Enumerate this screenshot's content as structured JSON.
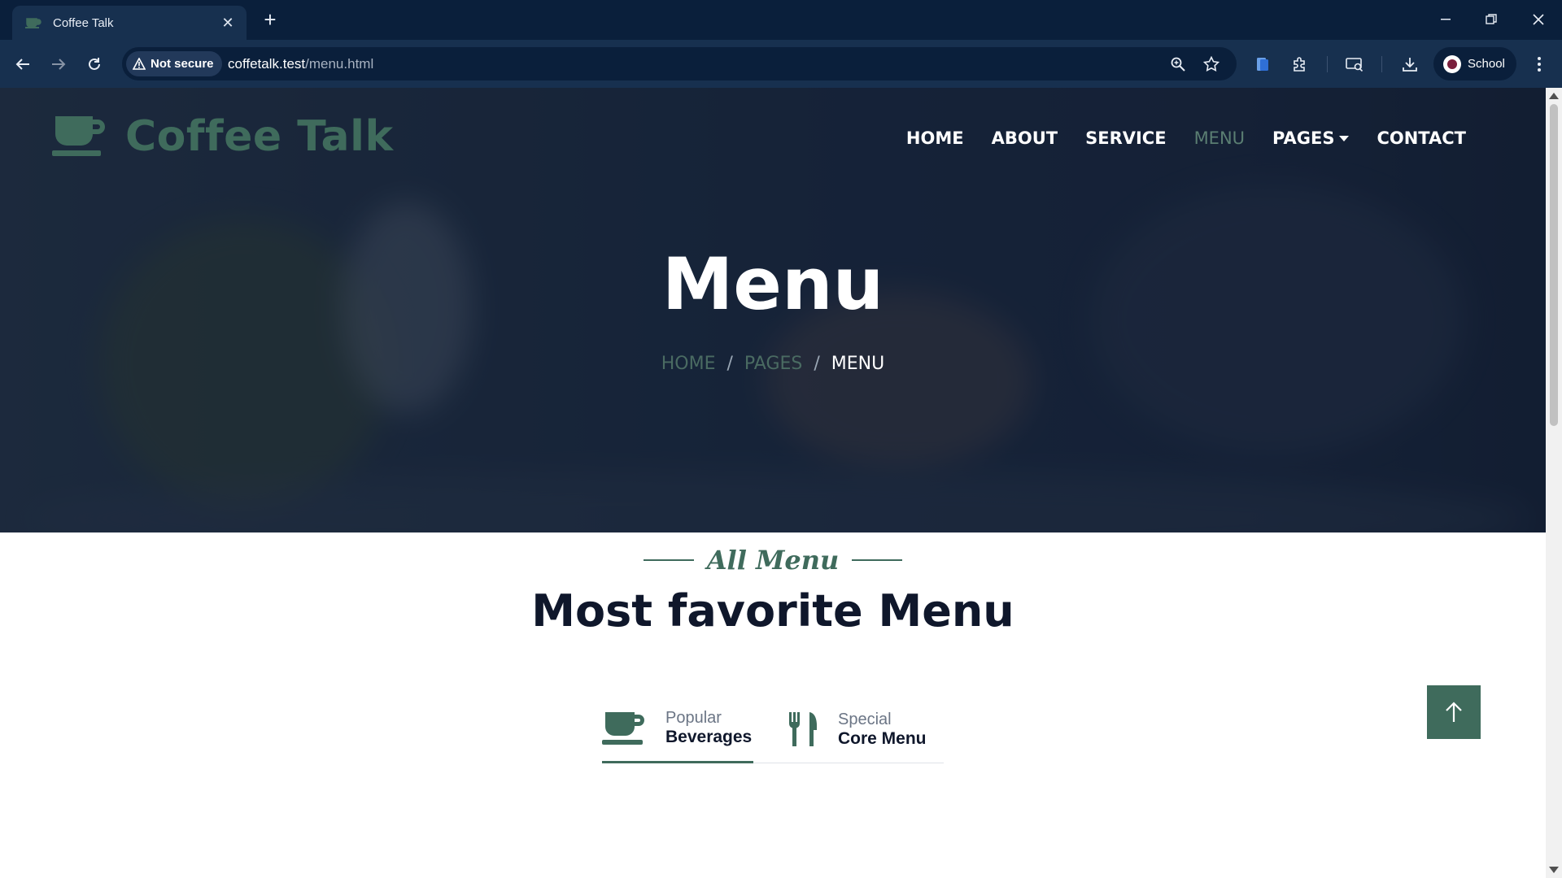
{
  "browser": {
    "tab_title": "Coffee Talk",
    "security_label": "Not secure",
    "url_host": "coffetalk.test",
    "url_path": "/menu.html",
    "profile_label": "School",
    "icons": [
      "back-icon",
      "forward-icon",
      "reload-icon",
      "zoom-icon",
      "bookmark-star-icon",
      "reading-list-icon",
      "extensions-icon",
      "media-cast-icon",
      "download-icon",
      "menu-kebab-icon"
    ]
  },
  "site": {
    "brand": "Coffee Talk",
    "nav": [
      {
        "label": "HOME"
      },
      {
        "label": "ABOUT"
      },
      {
        "label": "SERVICE"
      },
      {
        "label": "MENU",
        "active": true
      },
      {
        "label": "PAGES",
        "dropdown": true
      },
      {
        "label": "CONTACT"
      }
    ]
  },
  "hero": {
    "title": "Menu",
    "breadcrumb": {
      "home": "HOME",
      "pages": "PAGES",
      "current": "MENU",
      "separator": "/"
    }
  },
  "section": {
    "subtitle": "All Menu",
    "title": "Most favorite Menu",
    "tabs": [
      {
        "small": "Popular",
        "big": "Beverages",
        "icon": "coffee-cup-icon",
        "active": true
      },
      {
        "small": "Special",
        "big": "Core Menu",
        "icon": "utensils-icon",
        "active": false
      }
    ]
  },
  "colors": {
    "accent": "#3f6b5c",
    "dark": "#0f172b",
    "chrome": "#17304f"
  }
}
